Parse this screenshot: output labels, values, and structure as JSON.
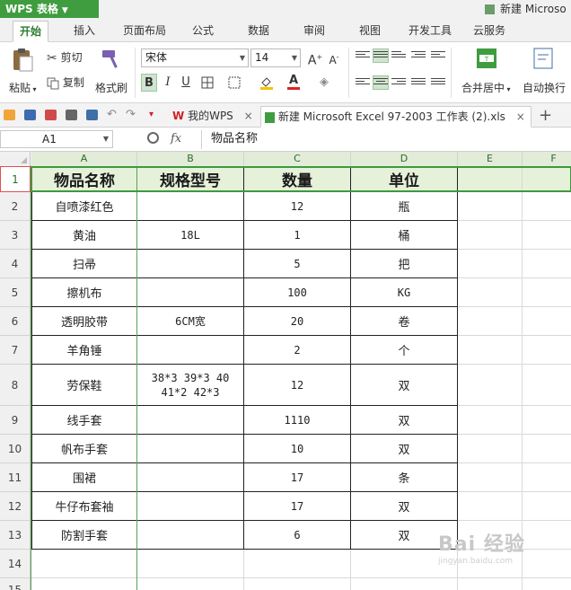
{
  "app": {
    "name": "WPS 表格",
    "doc_title": "新建 Microso"
  },
  "menu": {
    "tabs": [
      "开始",
      "插入",
      "页面布局",
      "公式",
      "数据",
      "审阅",
      "视图",
      "开发工具",
      "云服务"
    ],
    "active": "开始"
  },
  "ribbon": {
    "paste": "粘贴",
    "cut": "剪切",
    "copy": "复制",
    "format_painter": "格式刷",
    "font_name": "宋体",
    "font_size": "14",
    "bold": "B",
    "italic": "I",
    "underline": "U",
    "merge_center": "合并居中",
    "wrap_text": "自动换行",
    "font_color": "#e02020",
    "fill_color": "#f5c400"
  },
  "quickbar": {
    "wps_tab": "我的WPS",
    "doc_tab": "新建 Microsoft Excel 97-2003 工作表 (2).xls",
    "close": "×",
    "add": "+"
  },
  "formula_bar": {
    "cell_ref": "A1",
    "fx": "fx",
    "content": "物品名称"
  },
  "sheet": {
    "columns": [
      "A",
      "B",
      "C",
      "D",
      "E",
      "F"
    ],
    "rows": [
      "1",
      "2",
      "3",
      "4",
      "5",
      "6",
      "7",
      "8",
      "9",
      "10",
      "11",
      "12",
      "13",
      "14",
      "15"
    ],
    "header": [
      "物品名称",
      "规格型号",
      "数量",
      "单位"
    ],
    "data": [
      [
        "自喷漆红色",
        "",
        "12",
        "瓶"
      ],
      [
        "黄油",
        "18L",
        "1",
        "桶"
      ],
      [
        "扫帚",
        "",
        "5",
        "把"
      ],
      [
        "擦机布",
        "",
        "100",
        "KG"
      ],
      [
        "透明胶带",
        "6CM宽",
        "20",
        "卷"
      ],
      [
        "羊角锤",
        "",
        "2",
        "个"
      ],
      [
        "劳保鞋",
        "38*3 39*3 40 41*2 42*3",
        "12",
        "双"
      ],
      [
        "线手套",
        "",
        "1110",
        "双"
      ],
      [
        "帆布手套",
        "",
        "10",
        "双"
      ],
      [
        "围裙",
        "",
        "17",
        "条"
      ],
      [
        "牛仔布套袖",
        "",
        "17",
        "双"
      ],
      [
        "防割手套",
        "",
        "6",
        "双"
      ]
    ]
  },
  "watermark": {
    "text": "Bai 经验",
    "sub": "jingyan.baidu.com"
  }
}
